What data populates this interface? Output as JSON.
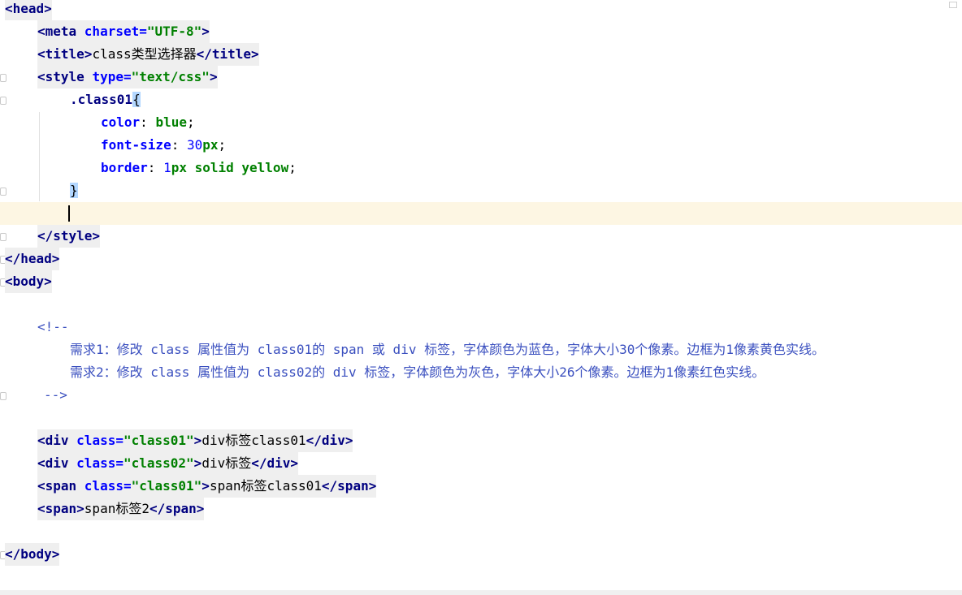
{
  "editor": {
    "lines": [
      [
        [
          "tag",
          "<head>"
        ]
      ],
      [
        [
          "tag",
          "<meta "
        ],
        [
          "attr",
          "charset="
        ],
        [
          "val",
          "\"UTF-8\""
        ],
        [
          "tag",
          ">"
        ]
      ],
      [
        [
          "tag",
          "<title>"
        ],
        [
          "txt",
          "class类型选择器"
        ],
        [
          "tag",
          "</title>"
        ]
      ],
      [
        [
          "tag",
          "<style "
        ],
        [
          "attr",
          "type="
        ],
        [
          "val",
          "\"text/css\""
        ],
        [
          "tag",
          ">"
        ]
      ],
      [
        [
          "sel",
          ".class01"
        ],
        [
          "brace",
          "{"
        ]
      ],
      [
        [
          "prop",
          "color"
        ],
        [
          "txt",
          ": "
        ],
        [
          "kw",
          "blue"
        ],
        [
          "txt",
          ";"
        ]
      ],
      [
        [
          "prop",
          "font-size"
        ],
        [
          "txt",
          ": "
        ],
        [
          "num",
          "30"
        ],
        [
          "kw",
          "px"
        ],
        [
          "txt",
          ";"
        ]
      ],
      [
        [
          "prop",
          "border"
        ],
        [
          "txt",
          ": "
        ],
        [
          "num",
          "1"
        ],
        [
          "kw",
          "px solid yellow"
        ],
        [
          "txt",
          ";"
        ]
      ],
      [
        [
          "brace",
          "}"
        ]
      ],
      [],
      [
        [
          "tag",
          "</style>"
        ]
      ],
      [
        [
          "tag",
          "</head>"
        ]
      ],
      [
        [
          "tag",
          "<body>"
        ]
      ],
      [],
      [
        [
          "cmt",
          "<!--"
        ]
      ],
      [
        [
          "cmt",
          "需求1：修改 class 属性值为 class01的 span 或 div 标签，字体颜色为蓝色，字体大小30个像素。边框为1像素黄色实线。"
        ]
      ],
      [
        [
          "cmt",
          "需求2：修改 class 属性值为 class02的 div 标签，字体颜色为灰色，字体大小26个像素。边框为1像素红色实线。"
        ]
      ],
      [
        [
          "cmt",
          "-->"
        ]
      ],
      [],
      [
        [
          "tag",
          "<div "
        ],
        [
          "attr",
          "class="
        ],
        [
          "val",
          "\"class01\""
        ],
        [
          "tag",
          ">"
        ],
        [
          "txt",
          "div标签class01"
        ],
        [
          "tag",
          "</div>"
        ]
      ],
      [
        [
          "tag",
          "<div "
        ],
        [
          "attr",
          "class="
        ],
        [
          "val",
          "\"class02\""
        ],
        [
          "tag",
          ">"
        ],
        [
          "txt",
          "div标签"
        ],
        [
          "tag",
          "</div>"
        ]
      ],
      [
        [
          "tag",
          "<span "
        ],
        [
          "attr",
          "class="
        ],
        [
          "val",
          "\"class01\""
        ],
        [
          "tag",
          ">"
        ],
        [
          "txt",
          "span标签class01"
        ],
        [
          "tag",
          "</span>"
        ]
      ],
      [
        [
          "tag",
          "<span>"
        ],
        [
          "txt",
          "span标签2"
        ],
        [
          "tag",
          "</span>"
        ]
      ],
      [],
      [
        [
          "tag",
          "</body>"
        ]
      ]
    ]
  }
}
